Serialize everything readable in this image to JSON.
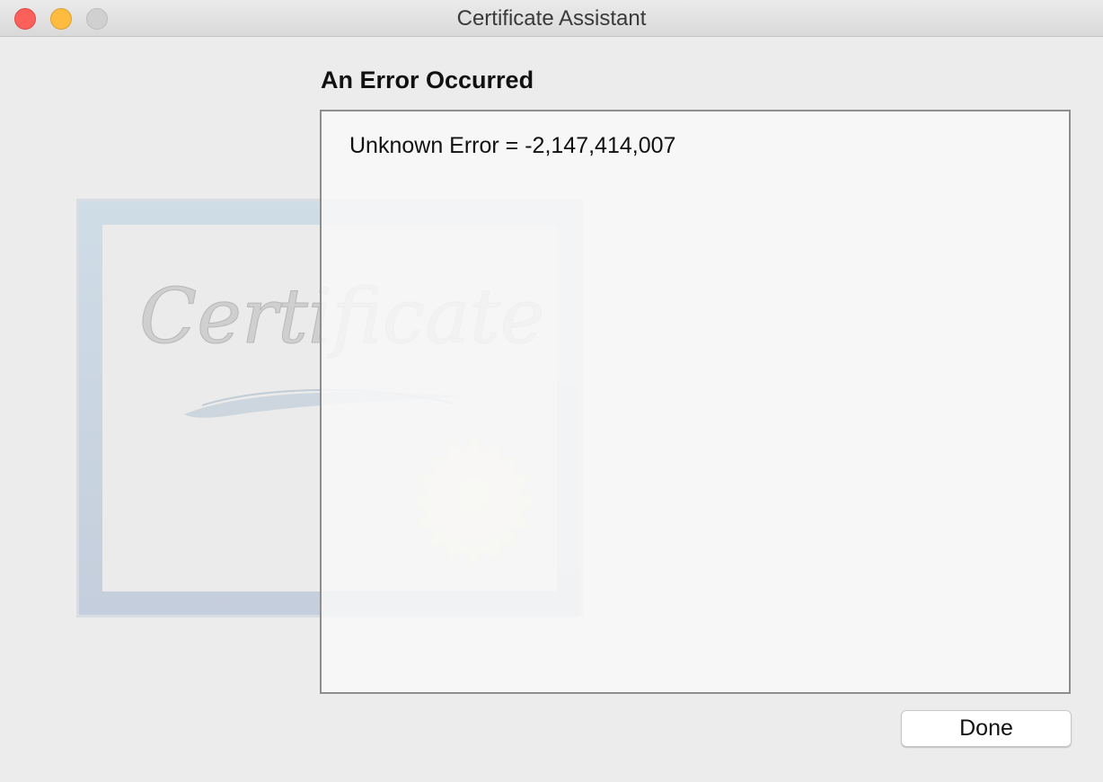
{
  "window": {
    "title": "Certificate Assistant"
  },
  "illustration": {
    "name": "certificate-illustration",
    "script_text": "Certificate"
  },
  "main": {
    "heading": "An Error Occurred",
    "message": "Unknown Error = -2,147,414,007"
  },
  "buttons": {
    "done_label": "Done"
  },
  "colors": {
    "close": "#fc605b",
    "minimize": "#fdbc40",
    "zoom_disabled": "#d0d0d0",
    "window_background": "#ececec"
  }
}
